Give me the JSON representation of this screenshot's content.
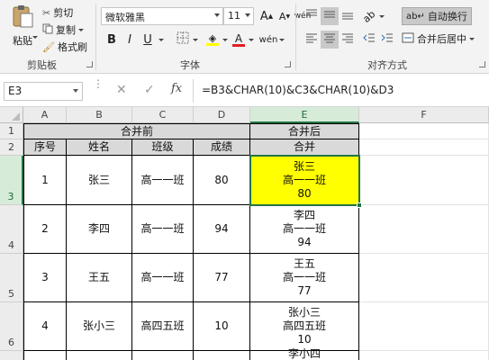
{
  "ribbon": {
    "clipboard": {
      "label": "剪贴板",
      "paste_label": "粘贴",
      "cut_label": "剪切",
      "copy_label": "复制",
      "format_painter_label": "格式刷"
    },
    "font": {
      "label": "字体",
      "font_name": "微软雅黑",
      "font_size": "11",
      "grow_label": "A",
      "shrink_label": "A",
      "wen_label": "wén",
      "bold_label": "B",
      "italic_label": "I",
      "underline_label": "U",
      "font_color_label": "A",
      "fill_color": "#ffff00",
      "font_color": "#e02020"
    },
    "alignment": {
      "label": "对齐方式",
      "wrap_text_label": "自动换行",
      "merge_center_label": "合并后居中"
    }
  },
  "formula_bar": {
    "name_box": "E3",
    "fx_label": "fx",
    "formula": "=B3&CHAR(10)&C3&CHAR(10)&D3"
  },
  "grid": {
    "columns": [
      "A",
      "B",
      "C",
      "D",
      "E",
      "F"
    ],
    "selected_column": "E",
    "rows": [
      "1",
      "2",
      "3",
      "4",
      "5",
      "6"
    ],
    "selected_row": "3",
    "header_before": "合并前",
    "header_after": "合并后",
    "subheaders": [
      "序号",
      "姓名",
      "班级",
      "成绩",
      "合并"
    ],
    "data": [
      {
        "seq": "1",
        "name": "张三",
        "class": "高一一班",
        "score": "80",
        "merged": "张三\n高一一班\n80"
      },
      {
        "seq": "2",
        "name": "李四",
        "class": "高一一班",
        "score": "94",
        "merged": "李四\n高一一班\n94"
      },
      {
        "seq": "3",
        "name": "王五",
        "class": "高一一班",
        "score": "77",
        "merged": "王五\n高一一班\n77"
      },
      {
        "seq": "4",
        "name": "张小三",
        "class": "高四五班",
        "score": "10",
        "merged": "张小三\n高四五班\n10"
      }
    ],
    "partial_next": "李小四"
  },
  "colors": {
    "accent": "#217346",
    "highlight": "#ffff00",
    "header_fill": "#d9d9d9"
  }
}
